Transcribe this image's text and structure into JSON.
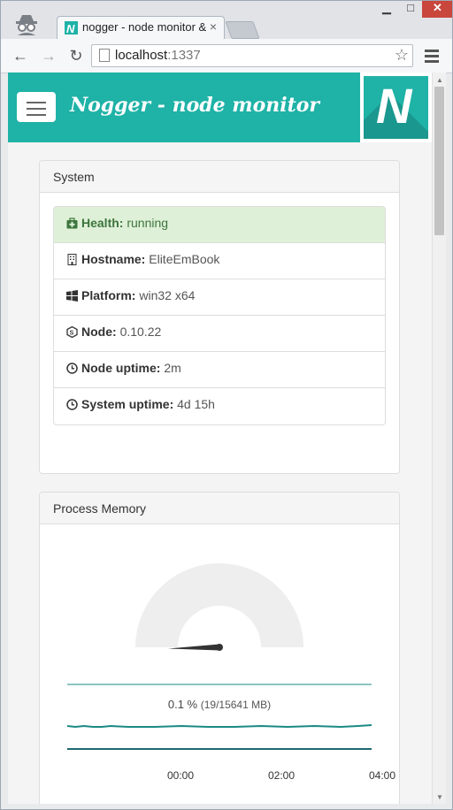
{
  "browser": {
    "tab_title": "nogger - node monitor & ",
    "tab_close": "×",
    "window_controls": {
      "minimize": "▁",
      "maximize": "□",
      "close": "✕"
    },
    "nav": {
      "back": "←",
      "forward": "→",
      "reload": "↻"
    },
    "url_host": "localhost",
    "url_port": ":1337",
    "bookmark_icon": "star-icon",
    "menu_icon": "hamburger-menu-icon"
  },
  "header": {
    "brand": "Nogger - node monitor",
    "logo_letter": "N",
    "accent_color": "#1fb2a7"
  },
  "system": {
    "title": "System",
    "items": [
      {
        "icon": "medkit-icon",
        "key": "Health:",
        "value": "running",
        "status": "success"
      },
      {
        "icon": "building-icon",
        "key": "Hostname:",
        "value": "EliteEmBook"
      },
      {
        "icon": "windows-icon",
        "key": "Platform:",
        "value": "win32 x64"
      },
      {
        "icon": "nodejs-icon",
        "key": "Node:",
        "value": "0.10.22"
      },
      {
        "icon": "clock-icon",
        "key": "Node uptime:",
        "value": "2m"
      },
      {
        "icon": "clock-icon",
        "key": "System uptime:",
        "value": "4d 15h"
      }
    ]
  },
  "memory": {
    "title": "Process Memory",
    "percent_text": "0.1 %",
    "detail_text": "(19/15641 MB)",
    "percent_value": 0.1,
    "used_mb": 19,
    "total_mb": 15641,
    "time_ticks": [
      "00:00",
      "02:00",
      "04:00"
    ],
    "series_color": "#1a8a83"
  }
}
